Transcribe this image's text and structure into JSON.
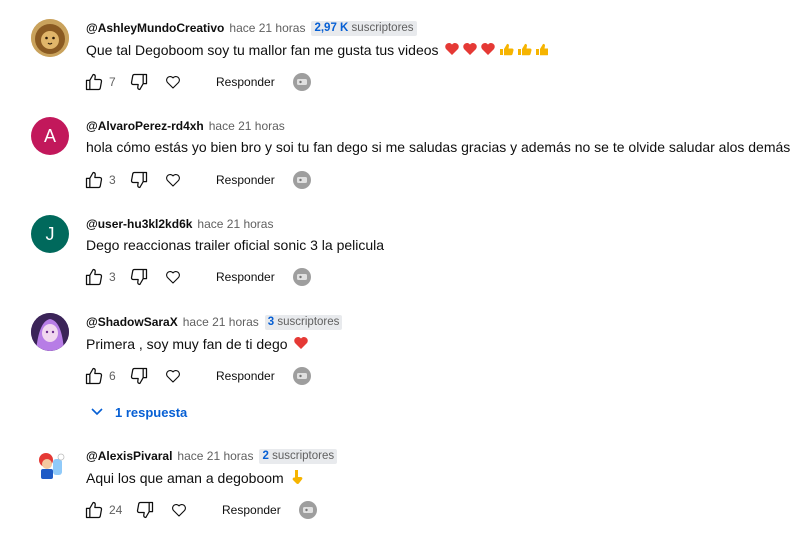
{
  "comments": [
    {
      "author": "@AshleyMundoCreativo",
      "time": "hace 21 horas",
      "badge_count": "2,97 K",
      "badge_unit": "suscriptores",
      "text": "Que tal Degoboom soy tu mallor fan me gusta tus videos",
      "emoji": "heart-heart-heart-thumbs-thumbs-thumbs",
      "likes": "7",
      "reply_label": "Responder",
      "avatar": "lion-avatar"
    },
    {
      "author": "@AlvaroPerez-rd4xh",
      "time": "hace 21 horas",
      "text": "hola cómo estás yo bien bro y soi tu fan dego si me saludas gracias y además no se te olvide saludar alos demás",
      "likes": "3",
      "reply_label": "Responder",
      "avatar_letter": "A",
      "avatar_color": "#c2185b"
    },
    {
      "author": "@user-hu3kl2kd6k",
      "time": "hace 21 horas",
      "text": "Dego reaccionas trailer oficial sonic 3 la pelicula",
      "likes": "3",
      "reply_label": "Responder",
      "avatar_letter": "J",
      "avatar_color": "#00695c"
    },
    {
      "author": "@ShadowSaraX",
      "time": "hace 21 horas",
      "badge_count": "3",
      "badge_unit": "suscriptores",
      "text": "Primera , soy muy fan de ti dego",
      "emoji": "heart",
      "likes": "6",
      "reply_label": "Responder",
      "avatar": "purple-character-avatar"
    },
    {
      "author": "@AlexisPivaral",
      "time": "hace 21 horas",
      "badge_count": "2",
      "badge_unit": "suscriptores",
      "text": "Aqui los que aman a degoboom",
      "emoji": "pointing-down",
      "likes": "24",
      "reply_label": "Responder",
      "avatar": "mario-avatar"
    }
  ],
  "replies_toggle": {
    "label": "1 respuesta"
  },
  "colors": {
    "link": "#065fd4",
    "muted": "#606060",
    "badge_bg": "#e8eaed"
  }
}
